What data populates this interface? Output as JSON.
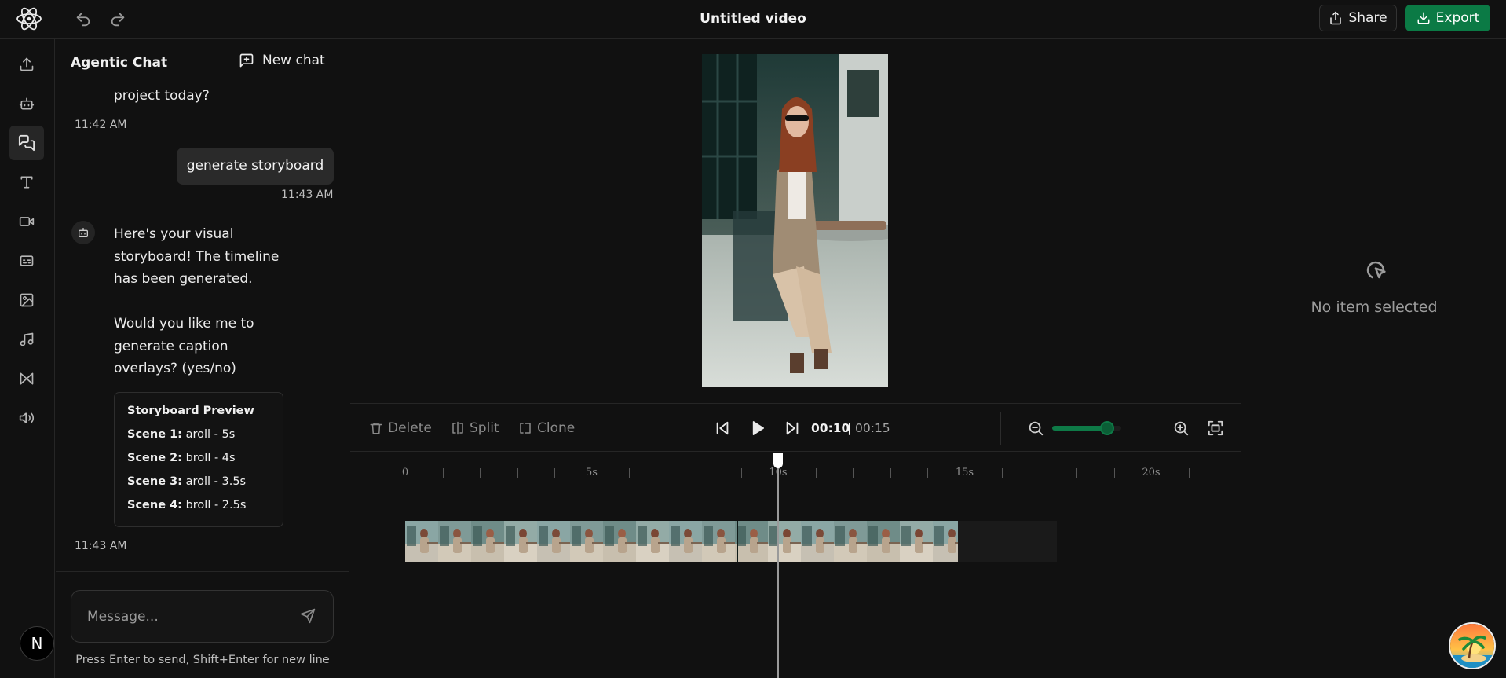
{
  "header": {
    "title": "Untitled video",
    "share_label": "Share",
    "export_label": "Export"
  },
  "sidebar": {
    "items": [
      {
        "name": "upload-icon"
      },
      {
        "name": "robot-icon"
      },
      {
        "name": "chat-icon",
        "active": true
      },
      {
        "name": "text-icon"
      },
      {
        "name": "video-icon"
      },
      {
        "name": "captions-icon"
      },
      {
        "name": "image-icon"
      },
      {
        "name": "music-icon"
      },
      {
        "name": "transitions-icon"
      },
      {
        "name": "audio-icon"
      }
    ],
    "avatar_letter": "N"
  },
  "chat": {
    "title": "Agentic Chat",
    "new_chat_label": "New chat",
    "messages": [
      {
        "role": "assistant",
        "text_tail": "project today?",
        "time": "11:42 AM"
      },
      {
        "role": "user",
        "text": "generate storyboard",
        "time": "11:43 AM"
      },
      {
        "role": "assistant",
        "lines": [
          "Here's your visual",
          "storyboard! The timeline",
          "has been generated.",
          "",
          "Would you like me to",
          "generate caption",
          "overlays? (yes/no)"
        ],
        "card": {
          "title": "Storyboard Preview",
          "scenes": [
            {
              "label": "Scene 1:",
              "value": "aroll - 5s"
            },
            {
              "label": "Scene 2:",
              "value": "broll - 4s"
            },
            {
              "label": "Scene 3:",
              "value": "aroll - 3.5s"
            },
            {
              "label": "Scene 4:",
              "value": "broll - 2.5s"
            }
          ]
        },
        "time": "11:43 AM"
      }
    ],
    "input_placeholder": "Message...",
    "hint": "Press Enter to send, Shift+Enter for new line"
  },
  "toolbar": {
    "delete_label": "Delete",
    "split_label": "Split",
    "clone_label": "Clone",
    "current_time": "00:10",
    "separator": "|",
    "total_time": "00:15",
    "zoom_level": 0.8
  },
  "timeline": {
    "ruler_labels": [
      "0",
      "5s",
      "10s",
      "15s",
      "20s"
    ],
    "playhead_seconds": 10
  },
  "inspector": {
    "empty_label": "No item selected"
  },
  "colors": {
    "accent": "#0b7a45",
    "background": "#111111",
    "border": "#262626"
  }
}
